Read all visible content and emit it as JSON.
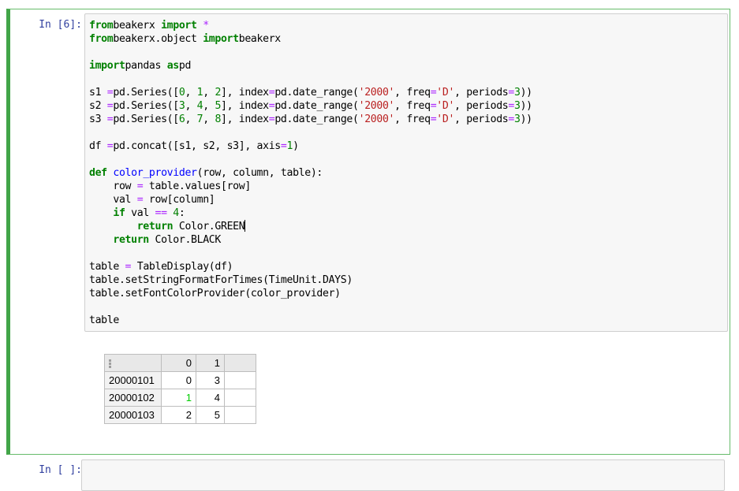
{
  "cells": [
    {
      "prompt": "In [6]:",
      "code_lines": [
        [
          [
            "kw",
            "from"
          ],
          [
            "",
            "beakerx "
          ],
          [
            "kw",
            "import"
          ],
          [
            "op",
            " *"
          ]
        ],
        [
          [
            "kw",
            "from"
          ],
          [
            "",
            "beakerx.object "
          ],
          [
            "kw",
            "import"
          ],
          [
            "",
            "beakerx"
          ]
        ],
        [],
        [
          [
            "kw",
            "import"
          ],
          [
            "",
            "pandas "
          ],
          [
            "kw",
            "as"
          ],
          [
            "",
            "pd"
          ]
        ],
        [],
        [
          [
            "",
            "s1 "
          ],
          [
            "op",
            "="
          ],
          [
            "",
            "pd.Series(["
          ],
          [
            "num",
            "0"
          ],
          [
            "",
            ", "
          ],
          [
            "num",
            "1"
          ],
          [
            "",
            ", "
          ],
          [
            "num",
            "2"
          ],
          [
            "",
            "], index"
          ],
          [
            "op",
            "="
          ],
          [
            "",
            "pd.date_range("
          ],
          [
            "str",
            "'2000'"
          ],
          [
            "",
            ", freq"
          ],
          [
            "op",
            "="
          ],
          [
            "str",
            "'D'"
          ],
          [
            "",
            ", periods"
          ],
          [
            "op",
            "="
          ],
          [
            "num",
            "3"
          ],
          [
            "",
            "))"
          ]
        ],
        [
          [
            "",
            "s2 "
          ],
          [
            "op",
            "="
          ],
          [
            "",
            "pd.Series(["
          ],
          [
            "num",
            "3"
          ],
          [
            "",
            ", "
          ],
          [
            "num",
            "4"
          ],
          [
            "",
            ", "
          ],
          [
            "num",
            "5"
          ],
          [
            "",
            "], index"
          ],
          [
            "op",
            "="
          ],
          [
            "",
            "pd.date_range("
          ],
          [
            "str",
            "'2000'"
          ],
          [
            "",
            ", freq"
          ],
          [
            "op",
            "="
          ],
          [
            "str",
            "'D'"
          ],
          [
            "",
            ", periods"
          ],
          [
            "op",
            "="
          ],
          [
            "num",
            "3"
          ],
          [
            "",
            "))"
          ]
        ],
        [
          [
            "",
            "s3 "
          ],
          [
            "op",
            "="
          ],
          [
            "",
            "pd.Series(["
          ],
          [
            "num",
            "6"
          ],
          [
            "",
            ", "
          ],
          [
            "num",
            "7"
          ],
          [
            "",
            ", "
          ],
          [
            "num",
            "8"
          ],
          [
            "",
            "], index"
          ],
          [
            "op",
            "="
          ],
          [
            "",
            "pd.date_range("
          ],
          [
            "str",
            "'2000'"
          ],
          [
            "",
            ", freq"
          ],
          [
            "op",
            "="
          ],
          [
            "str",
            "'D'"
          ],
          [
            "",
            ", periods"
          ],
          [
            "op",
            "="
          ],
          [
            "num",
            "3"
          ],
          [
            "",
            "))"
          ]
        ],
        [],
        [
          [
            "",
            "df "
          ],
          [
            "op",
            "="
          ],
          [
            "",
            "pd.concat([s1, s2, s3], axis"
          ],
          [
            "op",
            "="
          ],
          [
            "num",
            "1"
          ],
          [
            "",
            ")"
          ]
        ],
        [],
        [
          [
            "kw",
            "def"
          ],
          [
            "",
            " "
          ],
          [
            "fn",
            "color_provider"
          ],
          [
            "",
            "(row, column, table):"
          ]
        ],
        [
          [
            "",
            "    row "
          ],
          [
            "op",
            "="
          ],
          [
            "",
            " table.values[row]"
          ]
        ],
        [
          [
            "",
            "    val "
          ],
          [
            "op",
            "="
          ],
          [
            "",
            " row[column]"
          ]
        ],
        [
          [
            "",
            "    "
          ],
          [
            "kw",
            "if"
          ],
          [
            "",
            " val "
          ],
          [
            "op",
            "=="
          ],
          [
            "",
            " "
          ],
          [
            "num",
            "4"
          ],
          [
            "",
            ":"
          ]
        ],
        [
          [
            "",
            "        "
          ],
          [
            "kw",
            "return"
          ],
          [
            "",
            " Color.GREEN"
          ],
          [
            "cursor",
            ""
          ]
        ],
        [
          [
            "",
            "    "
          ],
          [
            "kw",
            "return"
          ],
          [
            "",
            " Color.BLACK"
          ]
        ],
        [],
        [
          [
            "",
            "table "
          ],
          [
            "op",
            "="
          ],
          [
            "",
            " TableDisplay(df)"
          ]
        ],
        [
          [
            "",
            "table.setStringFormatForTimes(TimeUnit.DAYS)"
          ]
        ],
        [
          [
            "",
            "table.setFontColorProvider(color_provider)"
          ]
        ],
        [],
        [
          [
            "",
            "table"
          ]
        ]
      ]
    },
    {
      "prompt": "In [ ]:",
      "code_lines": []
    }
  ],
  "output_table": {
    "header_icon": "menu-dots-icon",
    "columns": [
      "0",
      "1"
    ],
    "rows": [
      {
        "index": "20000101",
        "values": [
          "0",
          "3"
        ]
      },
      {
        "index": "20000102",
        "values": [
          "1",
          "4"
        ]
      },
      {
        "index": "20000103",
        "values": [
          "2",
          "5"
        ]
      }
    ],
    "highlight_color": "#00cc00",
    "default_color": "#000000"
  },
  "colors": {
    "active_border": "#42a548",
    "prompt": "#303f9f",
    "keyword": "#008000",
    "operator": "#aa22ff",
    "string": "#ba2121",
    "function": "#0000ff"
  }
}
